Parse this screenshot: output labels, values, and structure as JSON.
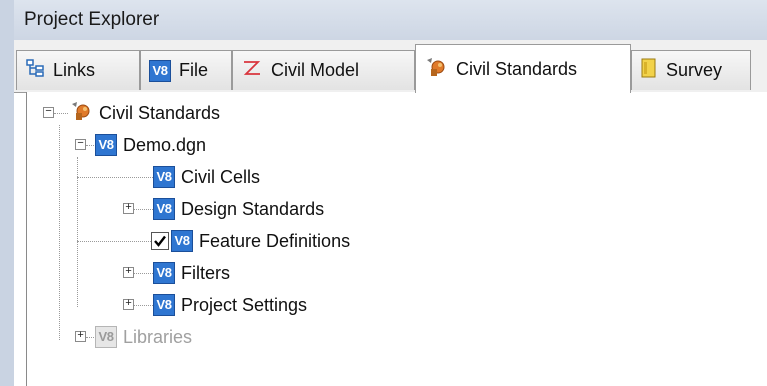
{
  "window": {
    "title": "Project Explorer"
  },
  "tabs": [
    {
      "label": "Links",
      "icon": "links-icon"
    },
    {
      "label": "File",
      "icon": "v8-icon"
    },
    {
      "label": "Civil Model",
      "icon": "civil-model-icon"
    },
    {
      "label": "Civil Standards",
      "icon": "civil-standards-icon",
      "active": true
    },
    {
      "label": "Survey",
      "icon": "survey-icon"
    }
  ],
  "tree": {
    "root": {
      "label": "Civil Standards",
      "expanded": true
    },
    "file": {
      "label": "Demo.dgn",
      "expanded": true
    },
    "children": [
      {
        "label": "Civil Cells",
        "expander": "none"
      },
      {
        "label": "Design Standards",
        "expander": "plus"
      },
      {
        "label": "Feature Definitions",
        "expander": "none",
        "checked": true
      },
      {
        "label": "Filters",
        "expander": "plus"
      },
      {
        "label": "Project Settings",
        "expander": "plus"
      }
    ],
    "libraries": {
      "label": "Libraries",
      "expander": "plus",
      "disabled": true
    }
  },
  "icons": {
    "v8_text": "V8"
  },
  "colors": {
    "title_bar": "#cdd6e4",
    "v8_blue": "#2f76d1",
    "disabled_text": "#a0a0a0"
  }
}
